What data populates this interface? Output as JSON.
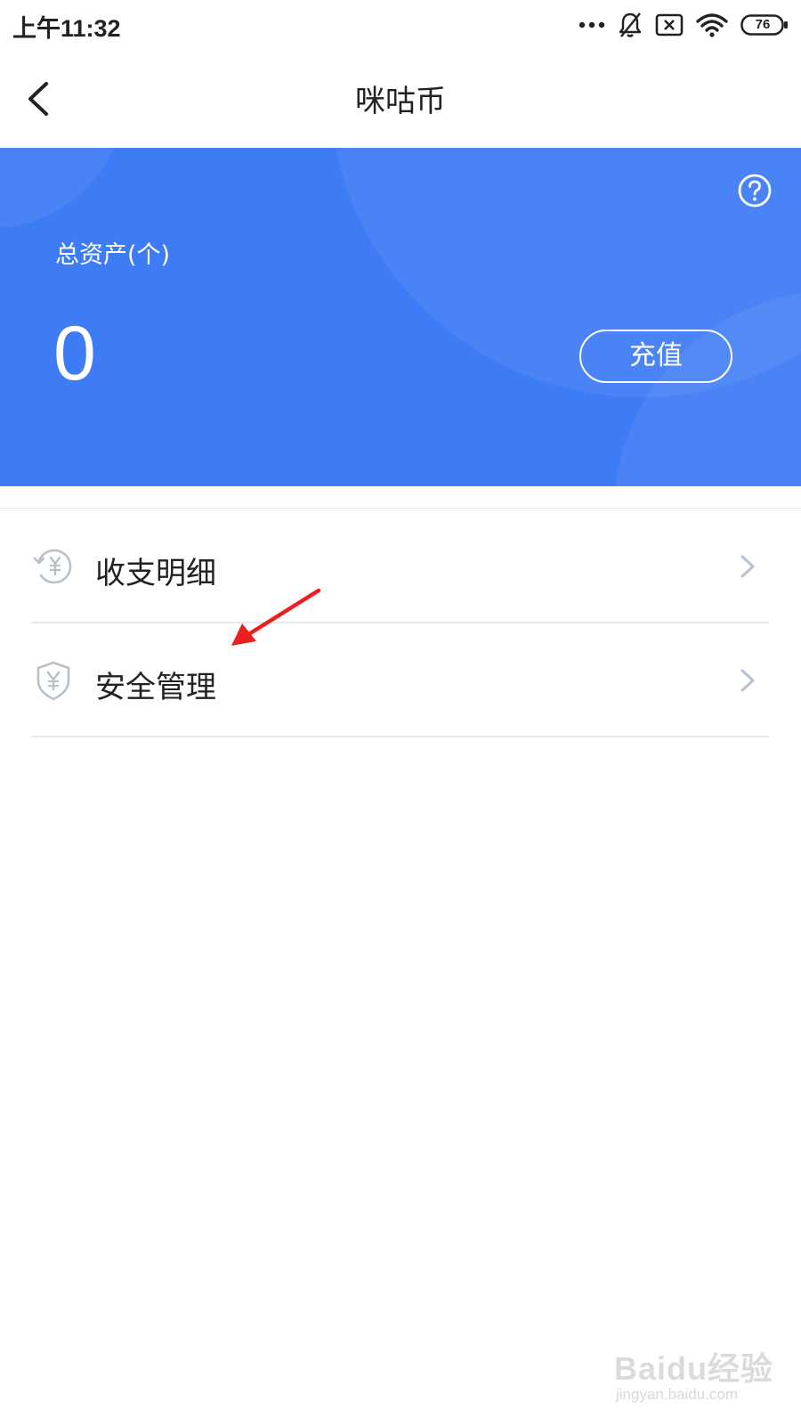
{
  "status_bar": {
    "time": "上午11:32",
    "battery": "76",
    "icons": [
      "more-dots-icon",
      "bell-off-icon",
      "sim-x-icon",
      "wifi-icon",
      "battery-icon"
    ]
  },
  "nav": {
    "title": "咪咕币",
    "back_icon": "chevron-left-icon"
  },
  "hero": {
    "assets_label": "总资产(个)",
    "assets_value": "0",
    "recharge_label": "充值",
    "help_icon": "question-circle-icon",
    "background_color": "#3e7cf6"
  },
  "menu": {
    "items": [
      {
        "label": "收支明细",
        "icon": "yen-history-icon"
      },
      {
        "label": "安全管理",
        "icon": "yen-shield-icon"
      }
    ]
  },
  "annotation": {
    "color": "#e8201f",
    "icon": "red-arrow-icon"
  },
  "watermark": {
    "main": "Baidu经验",
    "sub": "jingyan.baidu.com"
  }
}
